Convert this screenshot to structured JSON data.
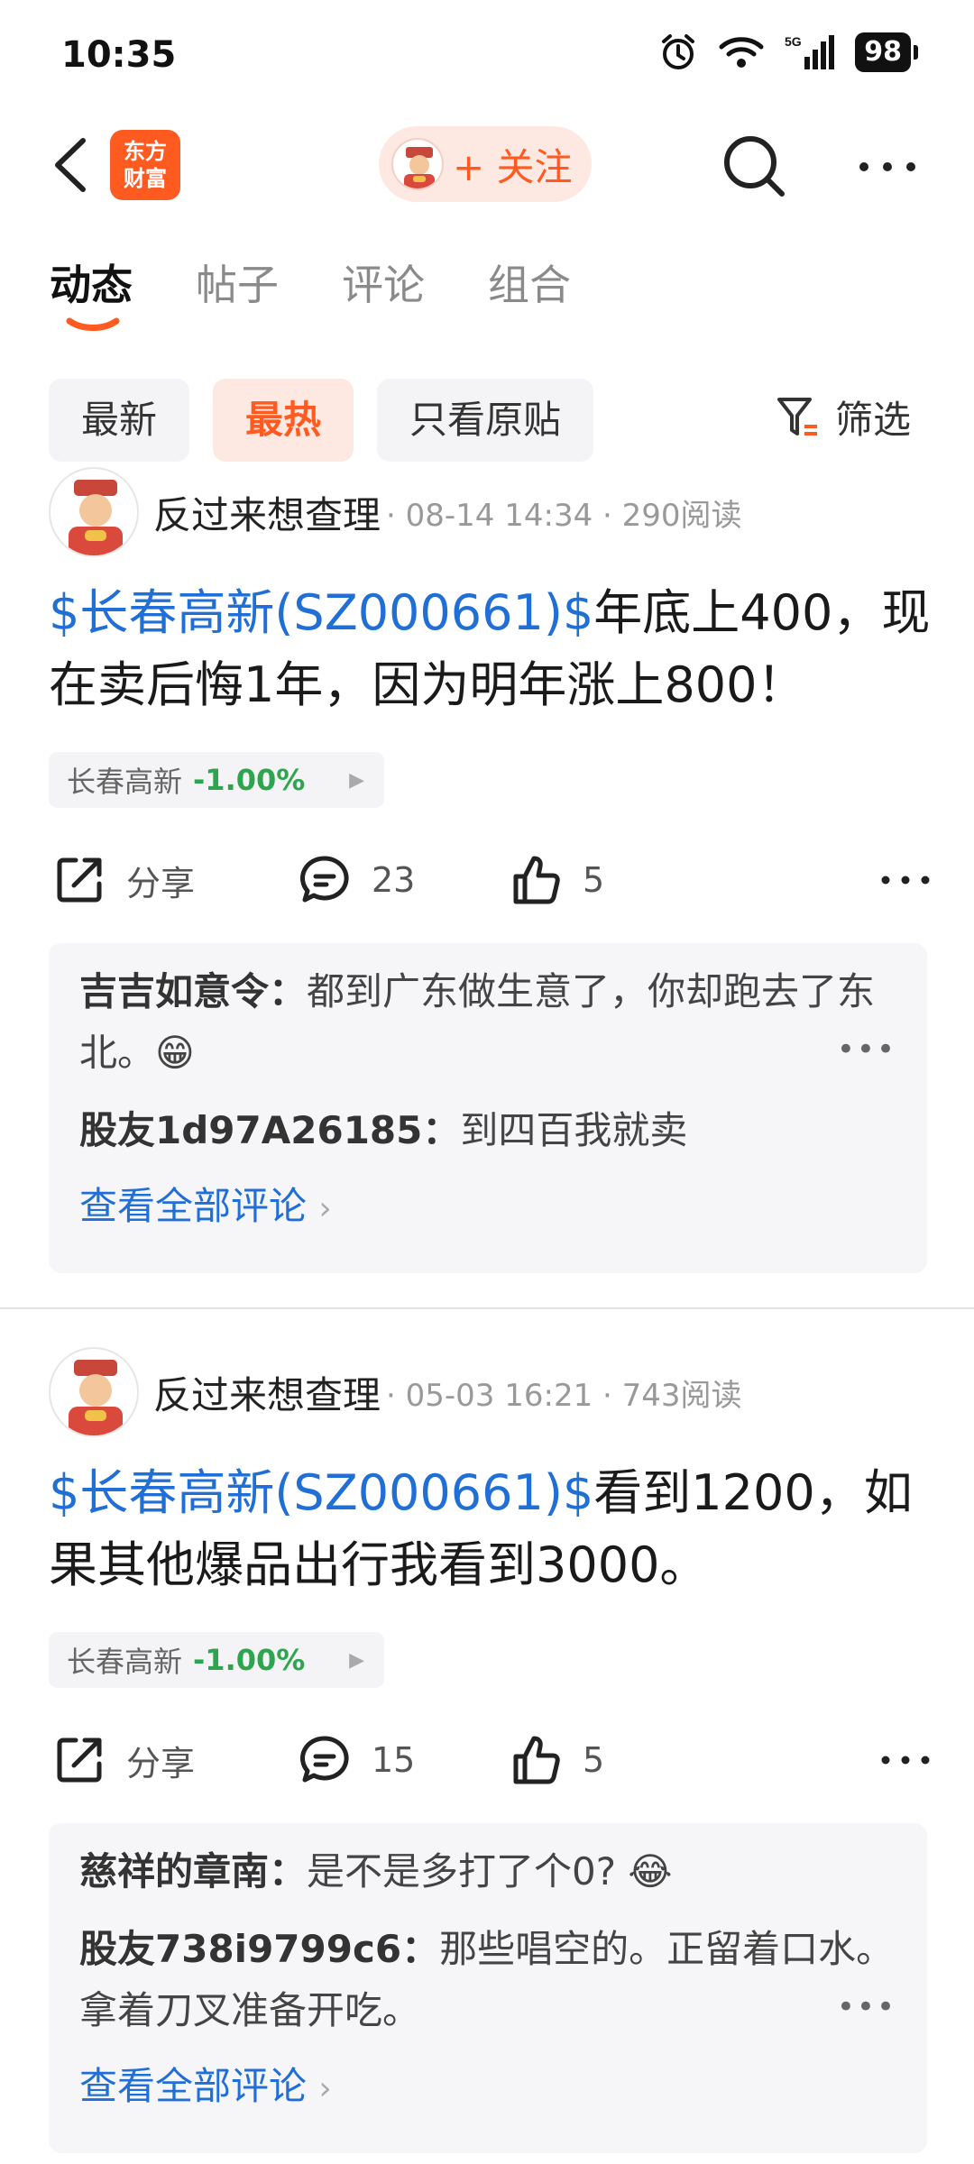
{
  "status_bar": {
    "time": "10:35",
    "battery": "98",
    "network": "5G"
  },
  "nav": {
    "logo_line1": "东方",
    "logo_line2": "财富",
    "follow_label": "+ 关注",
    "icons": [
      "back-icon",
      "search-icon",
      "more-icon"
    ]
  },
  "tabs": [
    {
      "label": "动态",
      "active": true
    },
    {
      "label": "帖子",
      "active": false
    },
    {
      "label": "评论",
      "active": false
    },
    {
      "label": "组合",
      "active": false
    }
  ],
  "filters": {
    "chips": [
      "最新",
      "最热",
      "只看原贴"
    ],
    "active": "最热",
    "filter_label": "筛选"
  },
  "colors": {
    "accent": "#ff5a1f",
    "link": "#1f6fd6",
    "up_down_green": "#2ea44f"
  },
  "posts": [
    {
      "author": "反过来想查理",
      "meta": "· 08-14 14:34 · 290阅读",
      "stock_tag": "$长春高新(SZ000661)$",
      "text": "年底上400，现在卖后悔1年，因为明年涨上800！",
      "stock_chip": {
        "name": "长春高新",
        "change": "-1.00%"
      },
      "share_label": "分享",
      "comment_count": "23",
      "like_count": "5",
      "comments": [
        {
          "user": "吉吉如意令：",
          "text": "都到广东做生意了，你却跑去了东北。😁",
          "truncated": true
        },
        {
          "user": "股友1d97A26185：",
          "text": "到四百我就卖",
          "truncated": false
        }
      ],
      "view_all": "查看全部评论"
    },
    {
      "author": "反过来想查理",
      "meta": "· 05-03 16:21 · 743阅读",
      "stock_tag": "$长春高新(SZ000661)$",
      "text": "看到1200，如果其他爆品出行我看到3000。",
      "stock_chip": {
        "name": "长春高新",
        "change": "-1.00%"
      },
      "share_label": "分享",
      "comment_count": "15",
      "like_count": "5",
      "comments": [
        {
          "user": "慈祥的章南：",
          "text": "是不是多打了个0? 😂",
          "truncated": false
        },
        {
          "user": "股友738i9799c6：",
          "text": "那些唱空的。正留着口水。拿着刀叉准备开吃。",
          "truncated": true
        }
      ],
      "view_all": "查看全部评论"
    }
  ]
}
